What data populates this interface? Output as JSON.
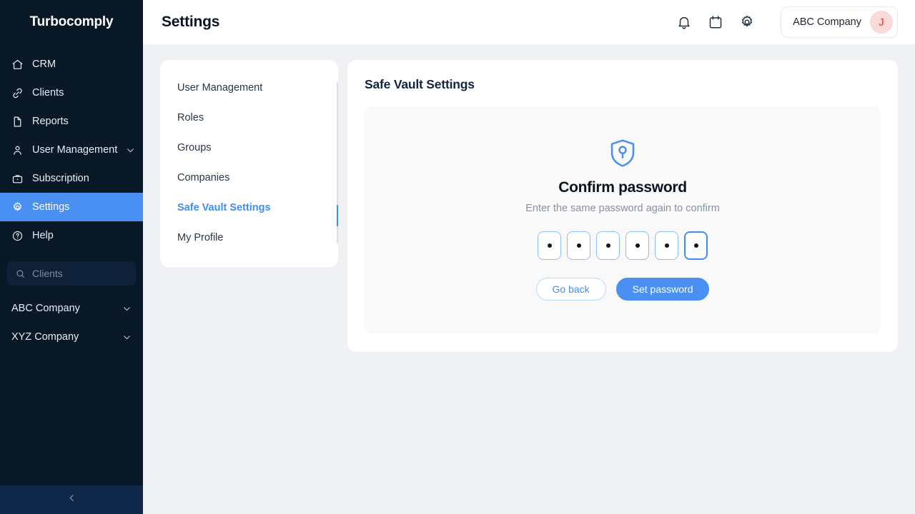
{
  "sidebar": {
    "brand": "Turbocomply",
    "items": [
      {
        "label": "CRM",
        "icon": "home-icon",
        "active": false,
        "chevron": false
      },
      {
        "label": "Clients",
        "icon": "link-icon",
        "active": false,
        "chevron": false
      },
      {
        "label": "Reports",
        "icon": "document-icon",
        "active": false,
        "chevron": false
      },
      {
        "label": "User Management",
        "icon": "user-icon",
        "active": false,
        "chevron": true
      },
      {
        "label": "Subscription",
        "icon": "briefcase-icon",
        "active": false,
        "chevron": false
      },
      {
        "label": "Settings",
        "icon": "gear-icon",
        "active": true,
        "chevron": false
      },
      {
        "label": "Help",
        "icon": "question-circle-icon",
        "active": false,
        "chevron": false
      }
    ],
    "search": {
      "placeholder": "Clients",
      "value": ""
    },
    "companies": [
      {
        "label": "ABC Company"
      },
      {
        "label": "XYZ Company"
      }
    ],
    "collapse_icon": "chevron-left-icon",
    "active_color": "#4a90f2",
    "background": "#081827"
  },
  "header": {
    "title": "Settings",
    "icons": [
      "bell-icon",
      "calendar-icon",
      "gear-icon"
    ],
    "account": {
      "company": "ABC Company",
      "avatar_initial": "J",
      "avatar_bg": "#fbd9d9",
      "avatar_color": "#e23b3b"
    }
  },
  "settings_nav": {
    "items": [
      {
        "label": "User Management",
        "active": false
      },
      {
        "label": "Roles",
        "active": false
      },
      {
        "label": "Groups",
        "active": false
      },
      {
        "label": "Companies",
        "active": false
      },
      {
        "label": "Safe Vault Settings",
        "active": true
      },
      {
        "label": "My Profile",
        "active": false
      }
    ],
    "active_color": "#3f8ef7"
  },
  "panel": {
    "title": "Safe Vault Settings",
    "vault": {
      "icon": "shield-keyhole-icon",
      "heading": "Confirm password",
      "subtitle": "Enter the same password again to confirm",
      "otp": {
        "length": 6,
        "filled": [
          true,
          true,
          true,
          true,
          true,
          true
        ],
        "focused_index": 5,
        "masked_char": "•"
      },
      "buttons": {
        "secondary": "Go back",
        "primary": "Set password"
      }
    }
  }
}
